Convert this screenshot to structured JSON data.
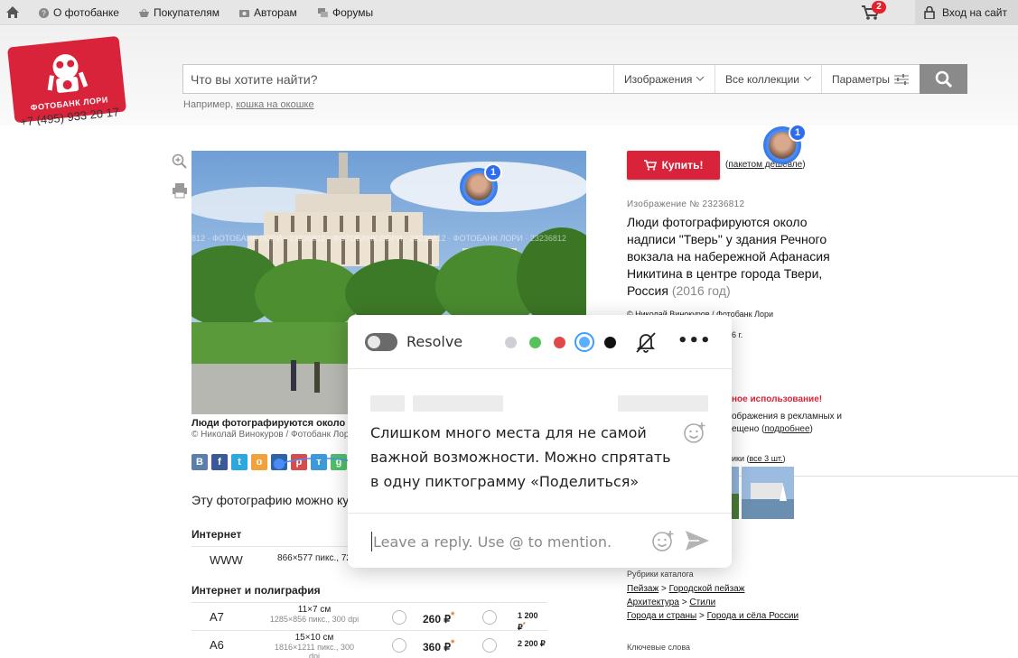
{
  "topnav": {
    "items": [
      {
        "label": "О фотобанке",
        "icon": "question-circle-icon"
      },
      {
        "label": "Покупателям",
        "icon": "basket-icon"
      },
      {
        "label": "Авторам",
        "icon": "camera-icon"
      },
      {
        "label": "Форумы",
        "icon": "chat-bubbles-icon"
      }
    ],
    "cart_count": "2",
    "login_label": "Вход на сайт"
  },
  "logo": {
    "text": "ФОТОБАНК ЛОРИ",
    "phone": "+7 (495) 933 20 17"
  },
  "search": {
    "placeholder": "Что вы хотите найти?",
    "type_label": "Изображения",
    "collections_label": "Все коллекции",
    "params_label": "Параметры",
    "example_prefix": "Например,",
    "example_link": "кошка на окошке"
  },
  "photo": {
    "caption": "Люди фотографируются около н",
    "credit": "© Николай Винокуров / Фотобанк Лори"
  },
  "social": [
    "В",
    "f",
    "t",
    "о",
    "м",
    "p",
    "т",
    "g"
  ],
  "usage_title": "Эту фотографию можно ку",
  "pricing": {
    "internet_title": "Интернет",
    "internet_rows": [
      {
        "format": "WWW",
        "size": "866×577 пикс., 72"
      }
    ],
    "print_title": "Интернет и полиграфия",
    "print_rows": [
      {
        "format": "A7",
        "size": "11×7 см",
        "size_sub": "1285×856 пикс., 300 dpi",
        "price1": "260 ₽",
        "price2": "1 200 ₽"
      },
      {
        "format": "A6",
        "size": "15×10 см",
        "size_sub": "1816×1211 пикс., 300 dpi",
        "price1": "360 ₽",
        "price2": "2 200 ₽"
      }
    ],
    "star": "*"
  },
  "right": {
    "buy_label": "Купить!",
    "packet_label": "пакетом дешевле",
    "image_number": "Изображение № 23236812",
    "title": "Люди фотографируются около надписи \"Тверь\" у здания Речного вокзала на набережной Афанасия Никитина в центре города Твери, Россия",
    "year": "(2016 год)",
    "author": "© Николай Винокуров / Фотобанк Лори",
    "year_partial": "6 г.",
    "warn_partial": "ное использование!",
    "warn2_partial": "ображения в рекламных и",
    "warn3_partial": "ещено (",
    "warn3_link": "подробнее",
    "warn3_end": ")",
    "series_partial": "ики (",
    "series_link": "все 3 шт.",
    "series_end": ")",
    "catalog_title": "Рубрики каталога",
    "catalog": [
      [
        "Пейзаж",
        "Городской пейзаж"
      ],
      [
        "Архитектура",
        "Стили"
      ],
      [
        "Города и страны",
        "Города и сёла России"
      ]
    ],
    "keywords_title": "Ключевые слова"
  },
  "pins": [
    {
      "count": "1"
    },
    {
      "count": "1"
    }
  ],
  "comment": {
    "resolve_label": "Resolve",
    "colors": [
      "#cfcfd6",
      "#56c35a",
      "#e0494c",
      "#5ab0ff",
      "#111111"
    ],
    "text": "Слишком много места для не самой важной возможности. Можно спрятать в одну пиктограмму «Поделиться»",
    "reply_placeholder": "Leave a reply. Use @ to mention."
  }
}
